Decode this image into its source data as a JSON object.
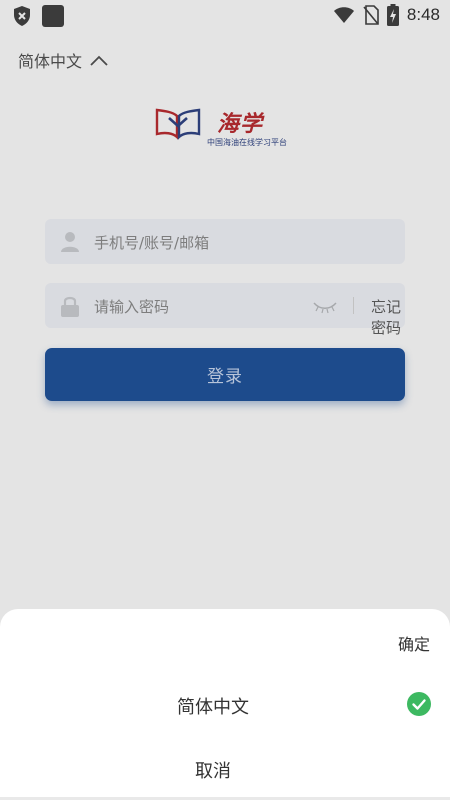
{
  "status_bar": {
    "time": "8:48",
    "icons": [
      "shield-icon",
      "app-square-icon",
      "wifi-icon",
      "no-sim-icon",
      "battery-charging-icon"
    ]
  },
  "language_switch": {
    "label": "简体中文",
    "icon": "chevron-up-icon"
  },
  "logo": {
    "title": "海学",
    "subtitle": "中国海油在线学习平台"
  },
  "login_form": {
    "account_placeholder": "手机号/账号/邮箱",
    "password_placeholder": "请输入密码",
    "forgot_label": "忘记密码",
    "login_label": "登录"
  },
  "language_sheet": {
    "confirm_label": "确定",
    "options": [
      {
        "label": "简体中文",
        "selected": true
      }
    ],
    "cancel_label": "取消"
  },
  "colors": {
    "primary": "#1d4b8c",
    "check": "#3db961",
    "logo_red": "#a8282c",
    "logo_blue": "#2c3e78"
  }
}
